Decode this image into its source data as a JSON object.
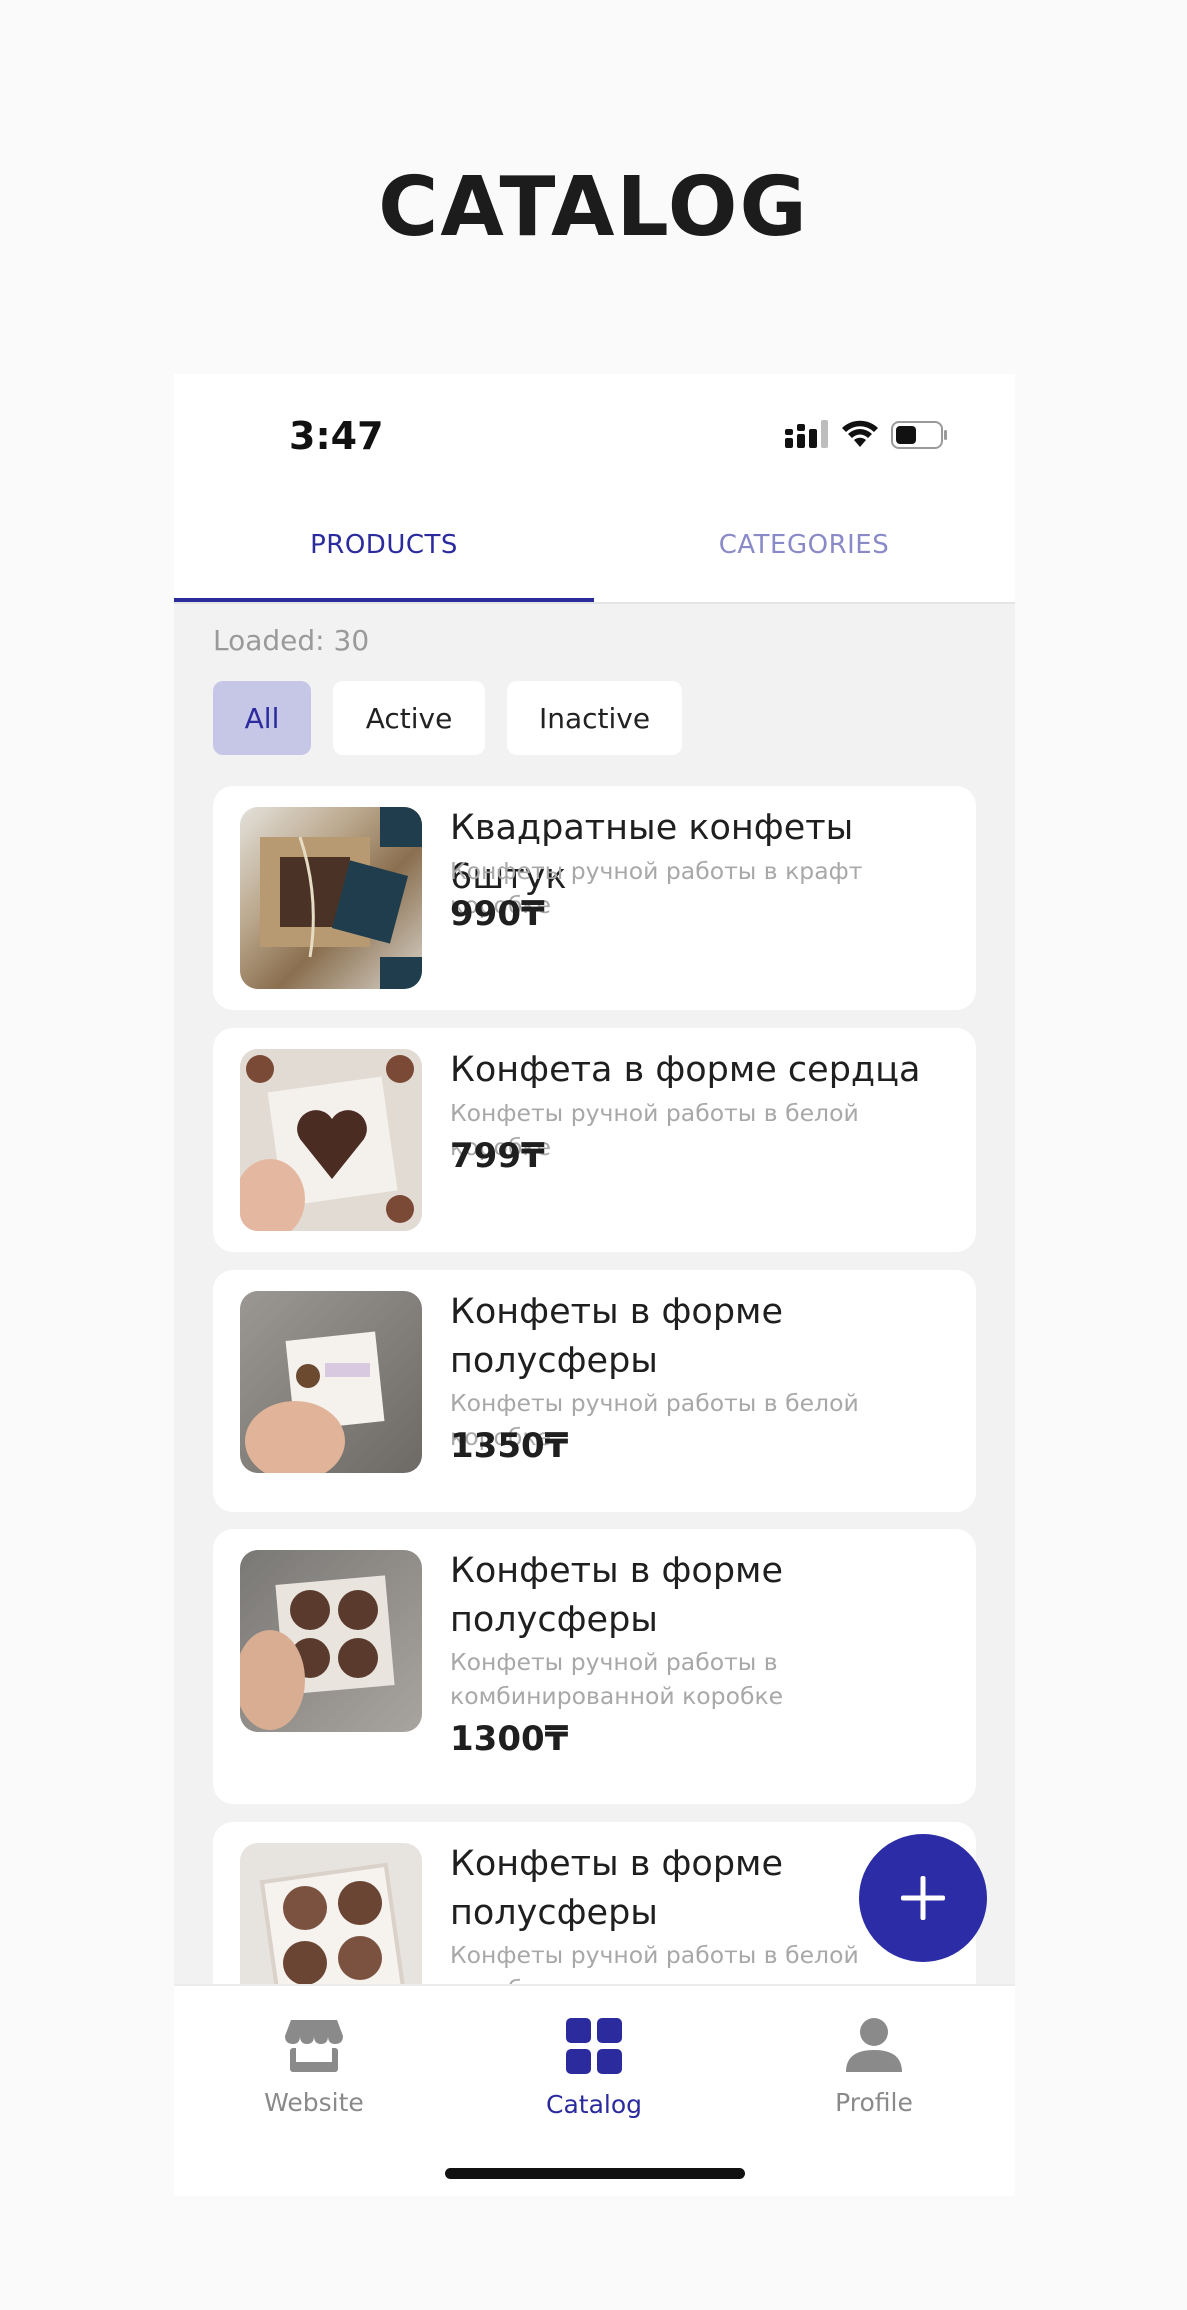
{
  "page": {
    "title": "CATALOG"
  },
  "status_bar": {
    "time": "3:47"
  },
  "tabs": [
    {
      "label": "PRODUCTS",
      "active": true
    },
    {
      "label": "CATEGORIES",
      "active": false
    }
  ],
  "loaded_text": "Loaded: 30",
  "filters": [
    {
      "label": "All",
      "selected": true
    },
    {
      "label": "Active",
      "selected": false
    },
    {
      "label": "Inactive",
      "selected": false
    }
  ],
  "products": [
    {
      "title": "Квадратные конфеты 6штук",
      "description": "Конфеты ручной работы в крафт коробке",
      "price": "990₸",
      "image": "kraft-box-candies-photo"
    },
    {
      "title": "Конфета в форме сердца",
      "description": "Конфеты ручной работы в белой коробке",
      "price": "799₸",
      "image": "heart-candy-photo"
    },
    {
      "title": "Конфеты в форме полусферы",
      "description": "Конфеты ручной работы в белой коробке",
      "price": "1350₸",
      "image": "white-box-in-hand-photo"
    },
    {
      "title": "Конфеты в форме полусферы",
      "description": "Конфеты ручной работы в комбинированной коробке",
      "price": "1300₸",
      "image": "four-candies-in-hand-photo"
    },
    {
      "title": "Конфеты в форме полусферы",
      "description": "Конфеты ручной работы в белой коробке",
      "price": "",
      "image": "four-candies-box-photo"
    }
  ],
  "fab": {
    "icon": "plus-icon"
  },
  "bottom_nav": [
    {
      "label": "Website",
      "icon": "storefront-icon",
      "active": false
    },
    {
      "label": "Catalog",
      "icon": "grid-icon",
      "active": true
    },
    {
      "label": "Profile",
      "icon": "person-icon",
      "active": false
    }
  ],
  "colors": {
    "accent": "#2b2b9e",
    "chip_selected_bg": "#c6c6e6",
    "background": "#f2f2f2"
  }
}
